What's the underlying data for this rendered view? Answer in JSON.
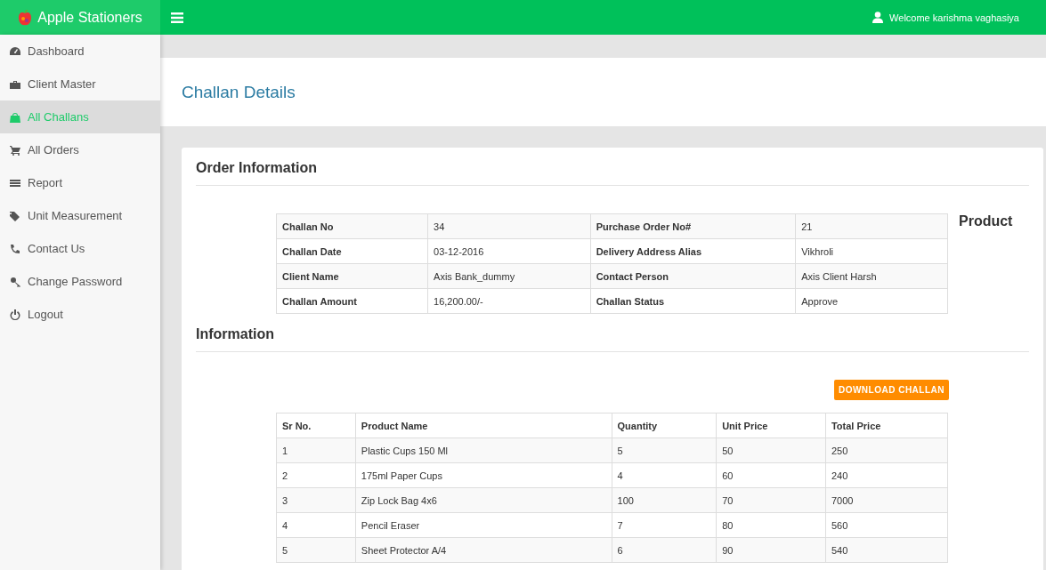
{
  "brand": {
    "name": "Apple Stationers"
  },
  "topbar": {
    "welcome": "Welcome karishma vaghasiya"
  },
  "sidebar": {
    "items": [
      {
        "label": "Dashboard",
        "selected": false
      },
      {
        "label": "Client Master",
        "selected": false
      },
      {
        "label": "All Challans",
        "selected": true
      },
      {
        "label": "All Orders",
        "selected": false
      },
      {
        "label": "Report",
        "selected": false
      },
      {
        "label": "Unit Measurement",
        "selected": false
      },
      {
        "label": "Contact Us",
        "selected": false
      },
      {
        "label": "Change Password",
        "selected": false
      },
      {
        "label": "Logout",
        "selected": false
      }
    ]
  },
  "page_title": "Challan Details",
  "order_heading": "Order Information",
  "order_table": {
    "rows": [
      [
        "Challan No",
        "34",
        "Purchase Order No#",
        "21"
      ],
      [
        "Challan Date",
        "03-12-2016",
        "Delivery Address Alias",
        "Vikhroli"
      ],
      [
        "Client Name",
        "Axis Bank_dummy",
        "Contact Person",
        "Axis Client Harsh"
      ],
      [
        "Challan Amount",
        "16,200.00/-",
        "Challan Status",
        "Approve"
      ]
    ]
  },
  "product_heading": "Product",
  "information_heading": "Information",
  "download_button": "DOWNLOAD CHALLAN",
  "product_table": {
    "columns": [
      "Sr No.",
      "Product Name",
      "Quantity",
      "Unit Price",
      "Total Price"
    ],
    "rows": [
      [
        "1",
        "Plastic Cups 150 Ml",
        "5",
        "50",
        "250"
      ],
      [
        "2",
        "175ml Paper Cups",
        "4",
        "60",
        "240"
      ],
      [
        "3",
        "Zip Lock Bag 4x6",
        "100",
        "70",
        "7000"
      ],
      [
        "4",
        "Pencil Eraser",
        "7",
        "80",
        "560"
      ],
      [
        "5",
        "Sheet Protector A/4",
        "6",
        "90",
        "540"
      ]
    ]
  }
}
